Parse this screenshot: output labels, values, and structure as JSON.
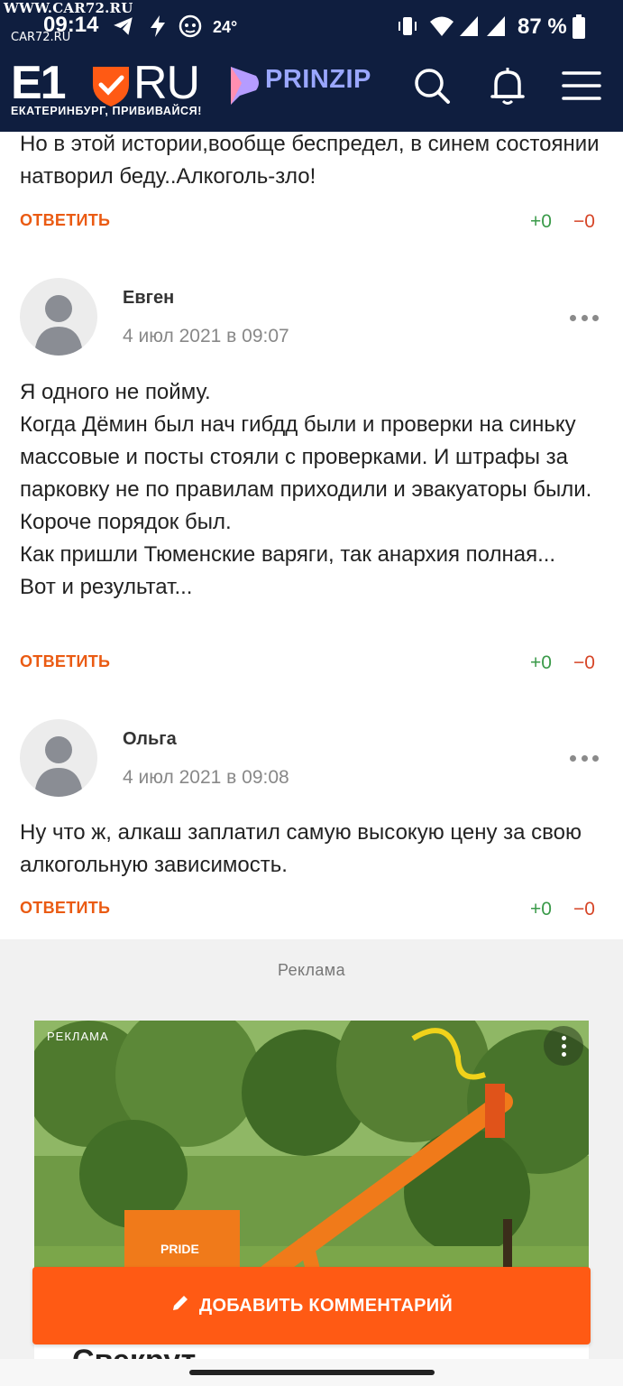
{
  "watermark": "WWW.CAR72.RU",
  "status_bar": {
    "time": "09:14",
    "time_watermark": "CAR72.RU",
    "temperature": "24°",
    "battery": "87 %"
  },
  "header": {
    "logo_main": "E1",
    "logo_suffix": "RU",
    "tagline": "ЕКАТЕРИНБУРГ, ПРИВИВАЙСЯ!",
    "partner": "PRINZIP",
    "colors": {
      "background": "#0f1e3f",
      "shield": "#ff5a14",
      "partner": "#9aa7ff"
    }
  },
  "comments": [
    {
      "text": "Но в этой истории,вообще беспредел, в синем состоянии натворил беду..Алкоголь-зло!",
      "reply_label": "ОТВЕТИТЬ",
      "votes_up": "+0",
      "votes_down": "−0"
    },
    {
      "author": "Евген",
      "date": "4 июл 2021 в 09:07",
      "text_lines": [
        "Я одного не пойму.",
        "Когда Дёмин был нач гибдд были и проверки на синьку массовые и посты стояли с проверками. И штрафы за парковку не по правилам приходили и эвакуаторы были. Короче порядок был.",
        "Как пришли Тюменские варяги, так анархия полная...",
        "Вот и результат..."
      ],
      "reply_label": "ОТВЕТИТЬ",
      "votes_up": "+0",
      "votes_down": "−0"
    },
    {
      "author": "Ольга",
      "date": "4 июл 2021 в 09:08",
      "text": "Ну что ж, алкаш заплатил самую высокую цену за свою алкогольную зависимость.",
      "reply_label": "ОТВЕТИТЬ",
      "votes_up": "+0",
      "votes_down": "−0"
    }
  ],
  "ad": {
    "section_label": "Реклама",
    "image_tag": "РЕКЛАМА",
    "brand_on_image": "PRIDE",
    "headline_partial": "Свекрут"
  },
  "add_comment_label": "ДОБАВИТЬ КОММЕНТАРИЙ"
}
